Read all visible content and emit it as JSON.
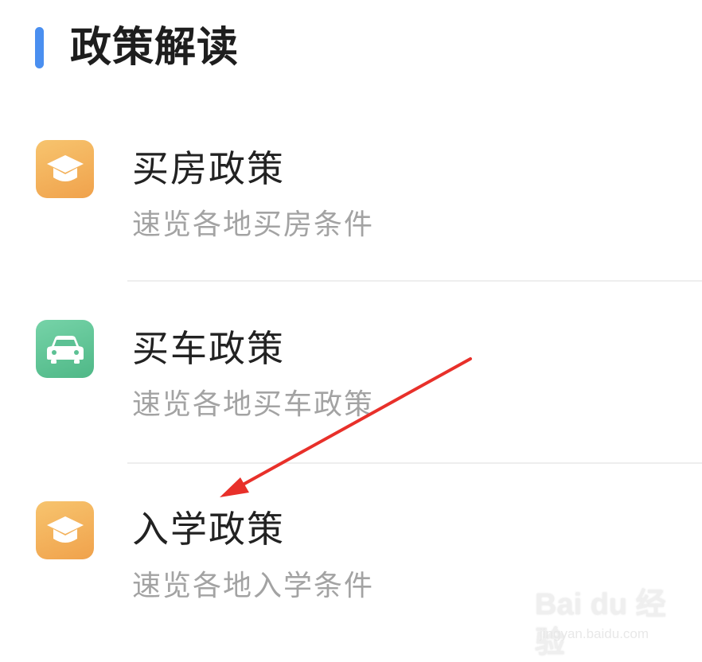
{
  "section": {
    "title": "政策解读",
    "accent_color": "#4a8ff0"
  },
  "items": [
    {
      "title": "买房政策",
      "subtitle": "速览各地买房条件",
      "icon": "graduation-cap-icon",
      "icon_color": "#f2a84f"
    },
    {
      "title": "买车政策",
      "subtitle": "速览各地买车政策",
      "icon": "car-icon",
      "icon_color": "#5cc194"
    },
    {
      "title": "入学政策",
      "subtitle": "速览各地入学条件",
      "icon": "graduation-cap-icon",
      "icon_color": "#f2a84f"
    }
  ],
  "annotation": {
    "arrow_color": "#e8302a"
  },
  "watermark": {
    "brand": "Bai du 经验",
    "url": "jingyan.baidu.com"
  }
}
